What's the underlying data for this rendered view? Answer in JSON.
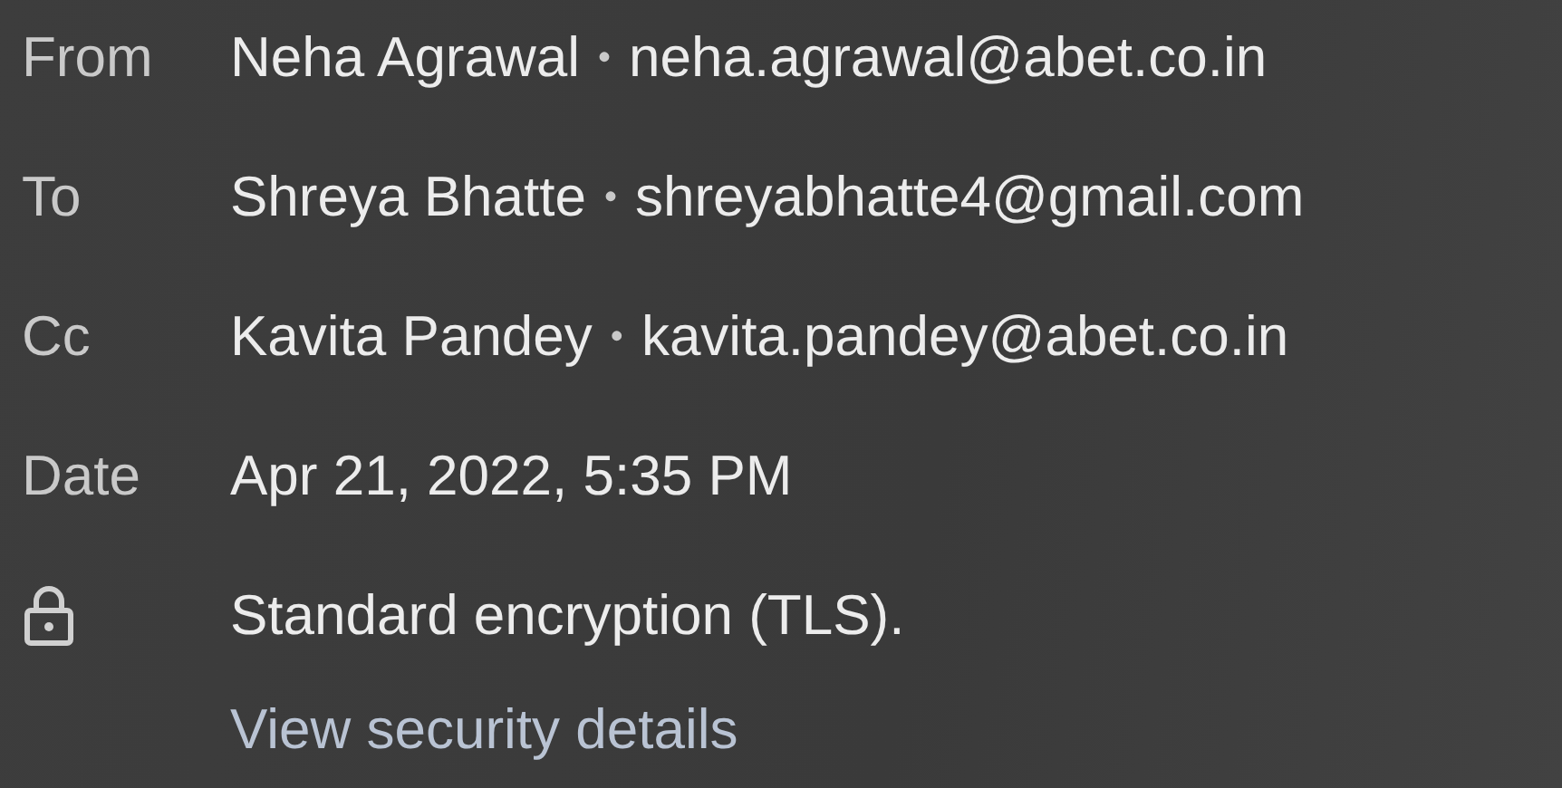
{
  "details": [
    {
      "label": "From",
      "name": "Neha Agrawal",
      "separator": "•",
      "email": "neha.agrawal@abet.co.in"
    },
    {
      "label": "To",
      "name": "Shreya Bhatte",
      "separator": "•",
      "email": "shreyabhatte4@gmail.com"
    },
    {
      "label": "Cc",
      "name": "Kavita Pandey",
      "separator": "•",
      "email": "kavita.pandey@abet.co.in"
    }
  ],
  "date": {
    "label": "Date",
    "value": "Apr 21, 2022, 5:35 PM"
  },
  "security": {
    "text": "Standard encryption (TLS).",
    "link": "View security details"
  }
}
